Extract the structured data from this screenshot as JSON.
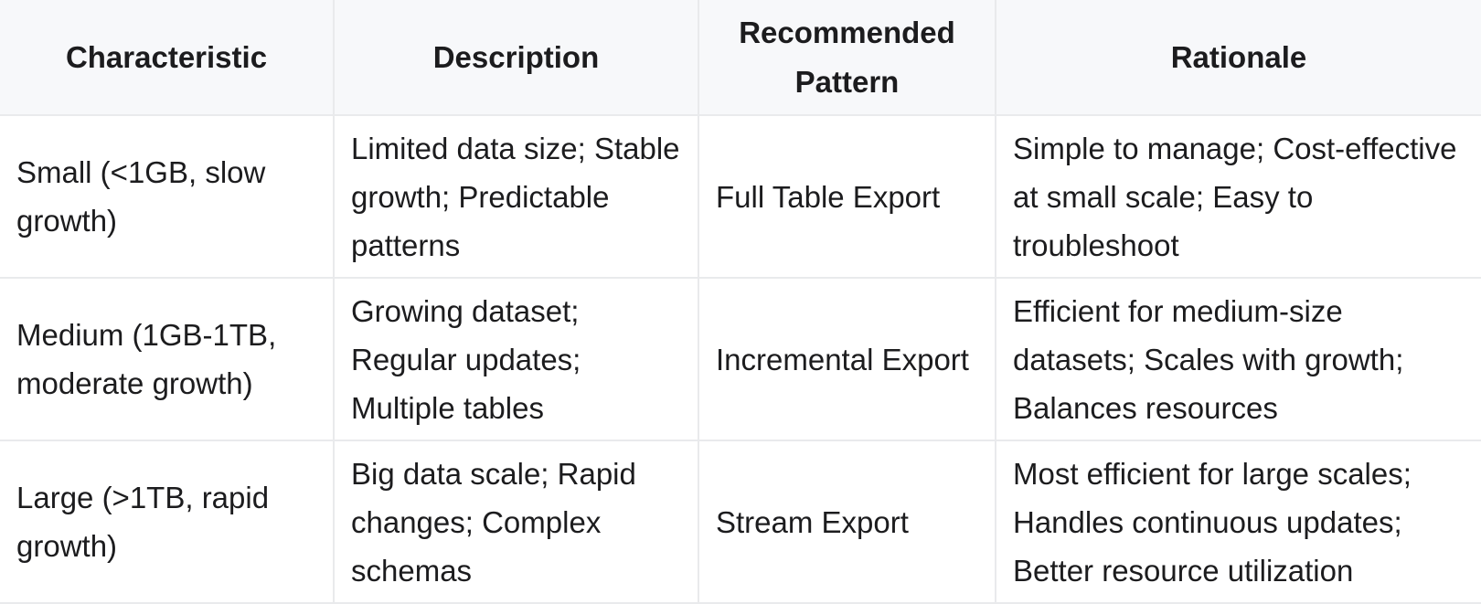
{
  "table": {
    "headers": [
      "Characteristic",
      "Description",
      "Recommended Pattern",
      "Rationale"
    ],
    "rows": [
      {
        "characteristic": "Small (<1GB, slow growth)",
        "description": "Limited data size; Stable growth; Predictable patterns",
        "pattern": "Full Table Export",
        "rationale": "Simple to manage; Cost-effective at small scale; Easy to troubleshoot"
      },
      {
        "characteristic": "Medium (1GB-1TB, moderate growth)",
        "description": "Growing dataset; Regular updates; Multiple tables",
        "pattern": "Incremental Export",
        "rationale": "Efficient for medium-size datasets; Scales with growth; Balances resources"
      },
      {
        "characteristic": "Large (>1TB, rapid growth)",
        "description": "Big data scale; Rapid changes; Complex schemas",
        "pattern": "Stream Export",
        "rationale": "Most efficient for large scales; Handles continuous updates; Better resource utilization"
      }
    ]
  }
}
